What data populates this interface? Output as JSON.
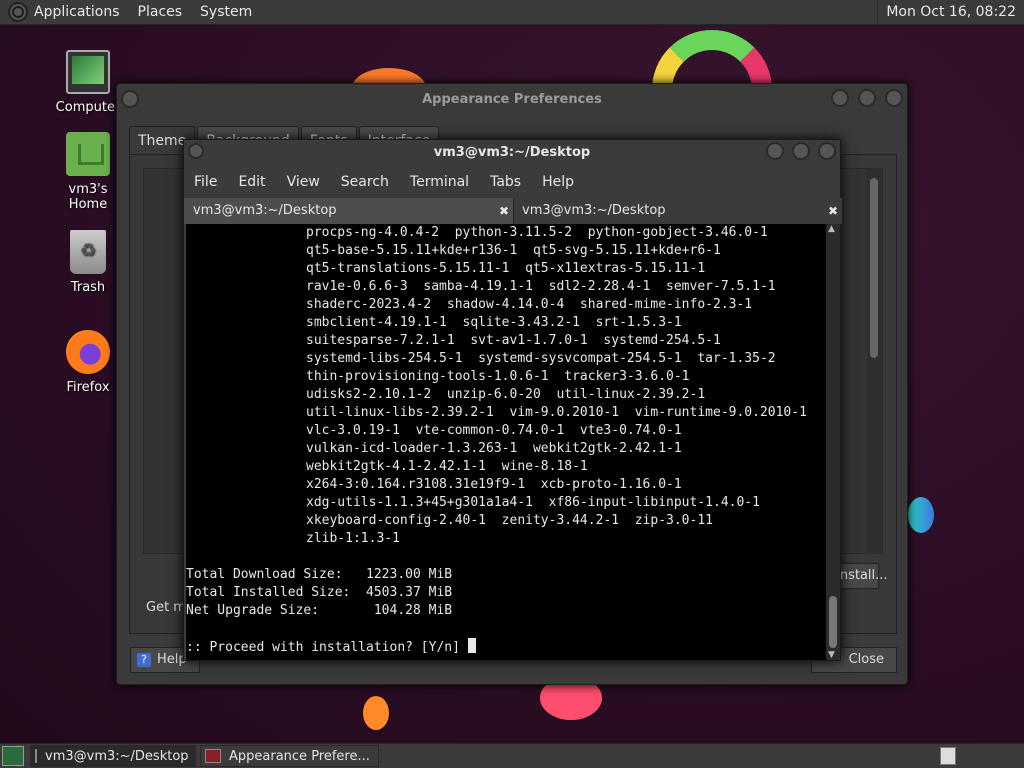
{
  "top_panel": {
    "menus": [
      "Applications",
      "Places",
      "System"
    ],
    "clock": "Mon Oct 16, 08:22"
  },
  "desktop_icons": [
    {
      "label": "Computer",
      "icon": "computer-icon"
    },
    {
      "label": "vm3's Home",
      "icon": "home-folder-icon"
    },
    {
      "label": "Trash",
      "icon": "trash-icon"
    },
    {
      "label": "Firefox",
      "icon": "firefox-icon"
    }
  ],
  "appearance_window": {
    "title": "Appearance Preferences",
    "tabs": [
      "Theme",
      "Background",
      "Fonts",
      "Interface"
    ],
    "get_more": "Get more themes online",
    "install_label": "Install...",
    "help_label": "Help",
    "close_label": "Close"
  },
  "terminal": {
    "title": "vm3@vm3:~/Desktop",
    "menus": [
      "File",
      "Edit",
      "View",
      "Search",
      "Terminal",
      "Tabs",
      "Help"
    ],
    "tabs": [
      {
        "label": "vm3@vm3:~/Desktop",
        "active": true
      },
      {
        "label": "vm3@vm3:~/Desktop",
        "active": false
      }
    ],
    "package_lines": [
      "procps-ng-4.0.4-2  python-3.11.5-2  python-gobject-3.46.0-1",
      "qt5-base-5.15.11+kde+r136-1  qt5-svg-5.15.11+kde+r6-1",
      "qt5-translations-5.15.11-1  qt5-x11extras-5.15.11-1",
      "rav1e-0.6.6-3  samba-4.19.1-1  sdl2-2.28.4-1  semver-7.5.1-1",
      "shaderc-2023.4-2  shadow-4.14.0-4  shared-mime-info-2.3-1",
      "smbclient-4.19.1-1  sqlite-3.43.2-1  srt-1.5.3-1",
      "suitesparse-7.2.1-1  svt-av1-1.7.0-1  systemd-254.5-1",
      "systemd-libs-254.5-1  systemd-sysvcompat-254.5-1  tar-1.35-2",
      "thin-provisioning-tools-1.0.6-1  tracker3-3.6.0-1",
      "udisks2-2.10.1-2  unzip-6.0-20  util-linux-2.39.2-1",
      "util-linux-libs-2.39.2-1  vim-9.0.2010-1  vim-runtime-9.0.2010-1",
      "vlc-3.0.19-1  vte-common-0.74.0-1  vte3-0.74.0-1",
      "vulkan-icd-loader-1.3.263-1  webkit2gtk-2.42.1-1",
      "webkit2gtk-4.1-2.42.1-1  wine-8.18-1",
      "x264-3:0.164.r3108.31e19f9-1  xcb-proto-1.16.0-1",
      "xdg-utils-1.1.3+45+g301a1a4-1  xf86-input-libinput-1.4.0-1",
      "xkeyboard-config-2.40-1  zenity-3.44.2-1  zip-3.0-11",
      "zlib-1:1.3-1"
    ],
    "summary_lines": [
      "Total Download Size:   1223.00 MiB",
      "Total Installed Size:  4503.37 MiB",
      "Net Upgrade Size:       104.28 MiB"
    ],
    "prompt": ":: Proceed with installation? [Y/n] "
  },
  "bottom_panel": {
    "tasks": [
      {
        "label": "vm3@vm3:~/Desktop",
        "icon": "terminal-icon",
        "active": true
      },
      {
        "label": "Appearance Prefere...",
        "icon": "appearance-icon",
        "active": false
      }
    ]
  }
}
